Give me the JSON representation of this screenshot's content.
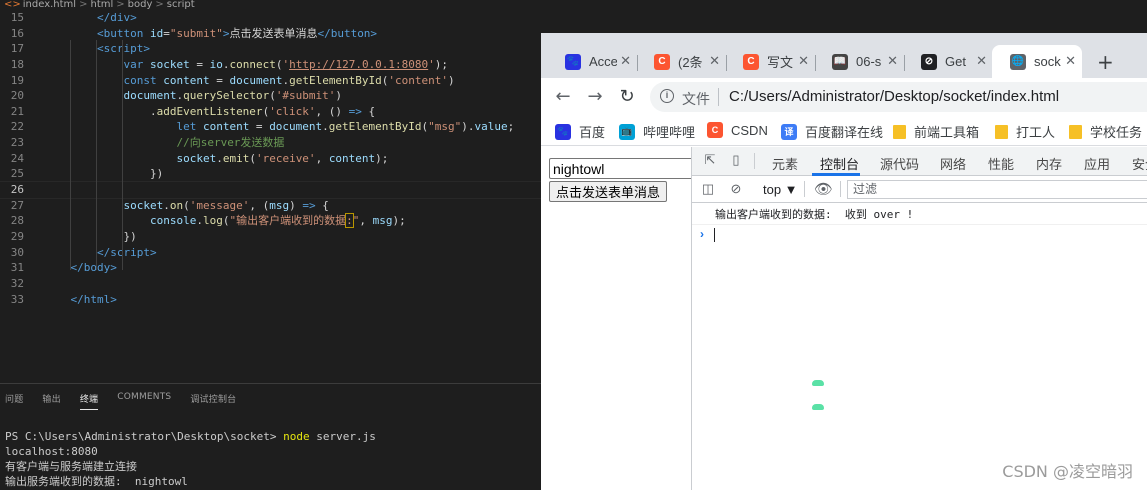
{
  "editor": {
    "breadcrumb": [
      "index.html",
      "html",
      "body",
      "script"
    ],
    "lines": [
      {
        "n": "15",
        "html": "        <span class='t-tag'>&lt;/div&gt;</span>"
      },
      {
        "n": "16",
        "html": "        <span class='t-tag'>&lt;button</span> <span class='t-attr'>id</span>=<span class='t-str'>\"submit\"</span><span class='t-tag'>&gt;</span>点击发送表单消息<span class='t-tag'>&lt;/button&gt;</span>"
      },
      {
        "n": "17",
        "html": "        <span class='t-tag'>&lt;script&gt;</span>"
      },
      {
        "n": "18",
        "html": "            <span class='t-kw'>var</span> <span class='t-var'>socket</span> = <span class='t-var'>io</span>.<span class='t-fn'>connect</span>(<span class='t-str'>'<u>http://127.0.0.1:8080</u>'</span>);"
      },
      {
        "n": "19",
        "html": "            <span class='t-kw'>const</span> <span class='t-var'>content</span> = <span class='t-var'>document</span>.<span class='t-fn'>getElementById</span>(<span class='t-str'>'content'</span>)"
      },
      {
        "n": "20",
        "html": "            <span class='t-var'>document</span>.<span class='t-fn'>querySelector</span>(<span class='t-str'>'#submit'</span>)"
      },
      {
        "n": "21",
        "html": "                .<span class='t-fn'>addEventListener</span>(<span class='t-str'>'click'</span>, () <span class='t-kw'>=&gt;</span> {"
      },
      {
        "n": "22",
        "html": "                    <span class='t-kw'>let</span> <span class='t-var'>content</span> = <span class='t-var'>document</span>.<span class='t-fn'>getElementById</span>(<span class='t-str'>\"msg\"</span>).<span class='t-var'>value</span>;"
      },
      {
        "n": "23",
        "html": "                    <span class='t-cmt'>//向server发送数据</span>"
      },
      {
        "n": "24",
        "html": "                    <span class='t-var'>socket</span>.<span class='t-fn'>emit</span>(<span class='t-str'>'receive'</span>, <span class='t-var'>content</span>);"
      },
      {
        "n": "25",
        "html": "                })"
      },
      {
        "n": "26",
        "html": ""
      },
      {
        "n": "27",
        "html": "            <span class='t-var'>socket</span>.<span class='t-fn'>on</span>(<span class='t-str'>'message'</span>, (<span class='t-var'>msg</span>) <span class='t-kw'>=&gt;</span> {"
      },
      {
        "n": "28",
        "html": "                <span class='t-var'>console</span>.<span class='t-fn'>log</span>(<span class='t-str'>\"输出客户端收到的数据<span class='t-hl'>:</span>\"</span>, <span class='t-var'>msg</span>);"
      },
      {
        "n": "29",
        "html": "            })"
      },
      {
        "n": "30",
        "html": "        <span class='t-tag'>&lt;/script&gt;</span>"
      },
      {
        "n": "31",
        "html": "    <span class='t-tag'>&lt;/body&gt;</span>"
      },
      {
        "n": "32",
        "html": ""
      },
      {
        "n": "33",
        "html": "    <span class='t-tag'>&lt;/html&gt;</span>"
      }
    ]
  },
  "panel": {
    "tabs": [
      "问题",
      "输出",
      "终端",
      "COMMENTS",
      "调试控制台"
    ],
    "active_tab": "终端",
    "terminal": {
      "prompt": "PS C:\\Users\\Administrator\\Desktop\\socket> ",
      "command": "node",
      "args": " server.js",
      "output": [
        "localhost:8080",
        "有客户端与服务端建立连接",
        "输出服务端收到的数据:  nightowl"
      ]
    }
  },
  "browser": {
    "tabs": [
      {
        "title": "Acce",
        "favicon_color": "#2932e1",
        "favicon_glyph": "🐾"
      },
      {
        "title": "(2条",
        "favicon_color": "#fc5531",
        "favicon_glyph": "C"
      },
      {
        "title": "写文",
        "favicon_color": "#fc5531",
        "favicon_glyph": "C"
      },
      {
        "title": "06-s",
        "favicon_color": "#444444",
        "favicon_glyph": "📖"
      },
      {
        "title": "Get",
        "favicon_color": "#202124",
        "favicon_glyph": "⊘"
      },
      {
        "title": "sock",
        "favicon_color": "#5f6368",
        "favicon_glyph": "🌐"
      }
    ],
    "address": {
      "label": "文件",
      "url": "C:/Users/Administrator/Desktop/socket/index.html"
    },
    "bookmarks": [
      {
        "label": "百度",
        "kind": "site",
        "color": "#2932e1",
        "glyph": "🐾"
      },
      {
        "label": "哔哩哔哩",
        "kind": "site",
        "color": "#00a1d6",
        "glyph": "📺"
      },
      {
        "label": "CSDN",
        "kind": "site",
        "color": "#fc5531",
        "glyph": "C"
      },
      {
        "label": "百度翻译在线",
        "kind": "site",
        "color": "#3d7cf6",
        "glyph": "译"
      },
      {
        "label": "前端工具箱",
        "kind": "folder"
      },
      {
        "label": "打工人",
        "kind": "folder"
      },
      {
        "label": "学校任务",
        "kind": "folder"
      }
    ],
    "page": {
      "input_value": "nightowl",
      "button_label": "点击发送表单消息"
    },
    "devtools": {
      "tabs": [
        "元素",
        "控制台",
        "源代码",
        "网络",
        "性能",
        "内存",
        "应用",
        "安全"
      ],
      "active_tab": "控制台",
      "context": "top ▼",
      "filter_placeholder": "过滤",
      "console_lines": [
        "输出客户端收到的数据:  收到 over !"
      ]
    }
  },
  "watermark": "CSDN @凌空暗羽"
}
